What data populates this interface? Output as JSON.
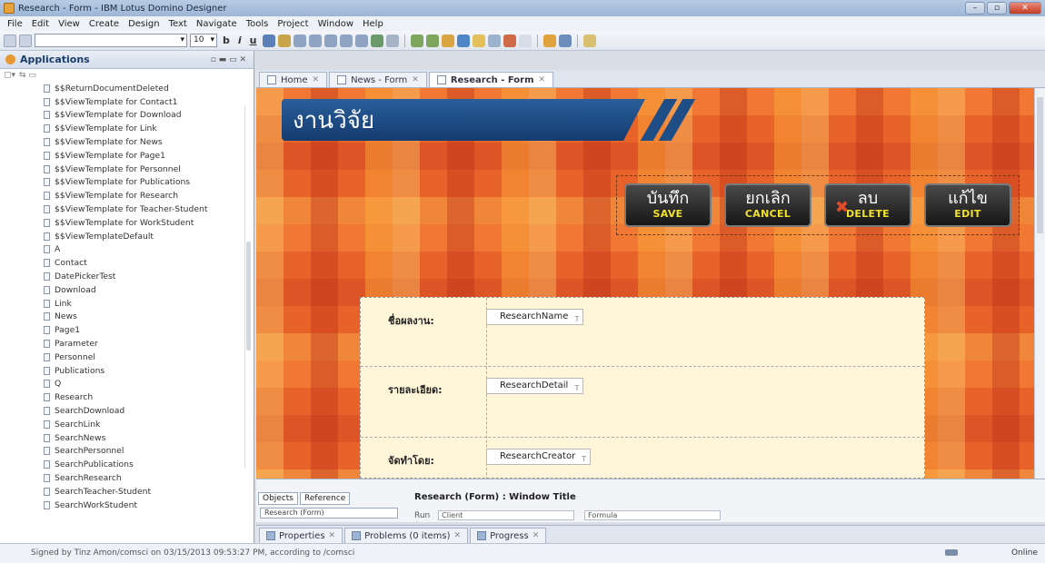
{
  "window": {
    "title": "Research - Form - IBM Lotus Domino Designer"
  },
  "menu": [
    "File",
    "Edit",
    "View",
    "Create",
    "Design",
    "Text",
    "Navigate",
    "Tools",
    "Project",
    "Window",
    "Help"
  ],
  "toolbar": {
    "font_size": "10",
    "bold": "b",
    "italic": "i",
    "underline": "u"
  },
  "applications": {
    "title": "Applications",
    "items": [
      "$$ReturnDocumentDeleted",
      "$$ViewTemplate for Contact1",
      "$$ViewTemplate for Download",
      "$$ViewTemplate for Link",
      "$$ViewTemplate for News",
      "$$ViewTemplate for Page1",
      "$$ViewTemplate for Personnel",
      "$$ViewTemplate for Publications",
      "$$ViewTemplate for Research",
      "$$ViewTemplate for Teacher-Student",
      "$$ViewTemplate for WorkStudent",
      "$$ViewTemplateDefault",
      "A",
      "Contact",
      "DatePickerTest",
      "Download",
      "Link",
      "News",
      "Page1",
      "Parameter",
      "Personnel",
      "Publications",
      "Q",
      "Research",
      "SearchDownload",
      "SearchLink",
      "SearchNews",
      "SearchPersonnel",
      "SearchPublications",
      "SearchResearch",
      "SearchTeacher-Student",
      "SearchWorkStudent"
    ]
  },
  "editor_tabs": [
    {
      "label": "Home"
    },
    {
      "label": "News - Form"
    },
    {
      "label": "Research - Form"
    }
  ],
  "canvas": {
    "banner_title": "งานวิจัย",
    "buttons": [
      {
        "th": "บันทึก",
        "en": "SAVE"
      },
      {
        "th": "ยกเลิก",
        "en": "CANCEL"
      },
      {
        "th": "ลบ",
        "en": "DELETE"
      },
      {
        "th": "แก้ไข",
        "en": "EDIT"
      }
    ],
    "fields": [
      {
        "label": "ชื่อผลงาน:",
        "field": "ResearchName"
      },
      {
        "label": "รายละเอียด:",
        "field": "ResearchDetail"
      },
      {
        "label": "จัดทำโดย:",
        "field": "ResearchCreator"
      }
    ]
  },
  "objects_pane": {
    "tab_objects": "Objects",
    "tab_reference": "Reference",
    "tree_item": "Research (Form)",
    "title": "Research (Form) : Window Title",
    "run_label": "Run",
    "run_value": "Client",
    "formula": "Formula"
  },
  "bottom_tabs": [
    {
      "label": "Properties"
    },
    {
      "label": "Problems (0 items)"
    },
    {
      "label": "Progress"
    }
  ],
  "status": {
    "message": "Signed by Tinz Amon/comsci on 03/15/2013 09:53:27 PM, according to /comsci",
    "online": "Online"
  }
}
